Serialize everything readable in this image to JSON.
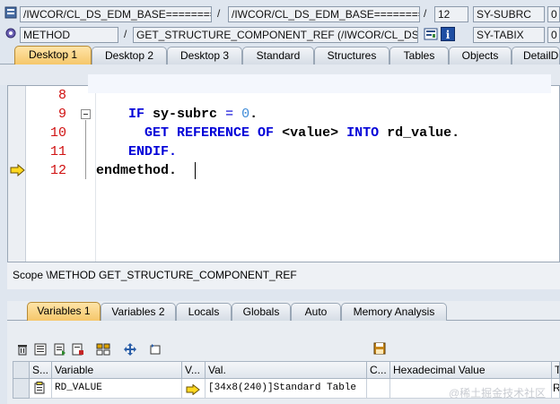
{
  "header": {
    "program": "/IWCOR/CL_DS_EDM_BASE=========",
    "include": "/IWCOR/CL_DS_EDM_BASE=========",
    "line": "12",
    "type": "METHOD",
    "event": "GET_STRUCTURE_COMPONENT_REF (/IWCOR/CL_DS_",
    "sys_field_1": "SY-SUBRC",
    "sys_value_1": "0",
    "sys_field_2": "SY-TABIX",
    "sys_value_2": "0",
    "separators": [
      "/",
      "/",
      "/"
    ]
  },
  "desktop_tabs": [
    {
      "label": "Desktop 1",
      "active": true
    },
    {
      "label": "Desktop 2",
      "active": false
    },
    {
      "label": "Desktop 3",
      "active": false
    },
    {
      "label": "Standard",
      "active": false
    },
    {
      "label": "Structures",
      "active": false
    },
    {
      "label": "Tables",
      "active": false
    },
    {
      "label": "Objects",
      "active": false
    },
    {
      "label": "DetailDi",
      "active": false
    }
  ],
  "code": {
    "line_numbers": [
      "8",
      "9",
      "10",
      "11",
      "12"
    ],
    "lines": [
      {
        "parts": []
      },
      {
        "parts": [
          {
            "t": "    "
          },
          {
            "t": "IF",
            "c": "kw"
          },
          {
            "t": " "
          },
          {
            "t": "sy-subrc",
            "c": "id"
          },
          {
            "t": " "
          },
          {
            "t": "=",
            "c": "op"
          },
          {
            "t": " "
          },
          {
            "t": "0",
            "c": "num"
          },
          {
            "t": ".",
            "c": "id"
          }
        ]
      },
      {
        "parts": [
          {
            "t": "      "
          },
          {
            "t": "GET REFERENCE OF",
            "c": "kw"
          },
          {
            "t": " "
          },
          {
            "t": "<value>",
            "c": "id"
          },
          {
            "t": " "
          },
          {
            "t": "INTO",
            "c": "kw"
          },
          {
            "t": " "
          },
          {
            "t": "rd_value",
            "c": "id"
          },
          {
            "t": ".",
            "c": "id"
          }
        ]
      },
      {
        "parts": [
          {
            "t": "    "
          },
          {
            "t": "ENDIF",
            "c": "kw"
          },
          {
            "t": ".",
            "c": "kw"
          }
        ]
      },
      {
        "parts": [
          {
            "t": "endmethod",
            "c": "id"
          },
          {
            "t": ".",
            "c": "id"
          }
        ]
      }
    ]
  },
  "scope_text": "Scope \\METHOD GET_STRUCTURE_COMPONENT_REF",
  "variable_tabs": [
    {
      "label": "Variables 1",
      "active": true
    },
    {
      "label": "Variables 2",
      "active": false
    },
    {
      "label": "Locals",
      "active": false
    },
    {
      "label": "Globals",
      "active": false
    },
    {
      "label": "Auto",
      "active": false
    },
    {
      "label": "Memory Analysis",
      "active": false
    }
  ],
  "grid": {
    "columns": [
      "S...",
      "Variable",
      "V...",
      "Val.",
      "C...",
      "Hexadecimal Value",
      "T"
    ],
    "rows": [
      {
        "variable": "RD_VALUE",
        "value": "[34x8(240)]Standard Table",
        "hex": "",
        "type": "R"
      }
    ]
  },
  "watermark": "@稀土掘金技术社区",
  "colors": {
    "accent_tab": "#f5c76a",
    "keyword": "#0000d8",
    "line_number": "#d01010"
  }
}
